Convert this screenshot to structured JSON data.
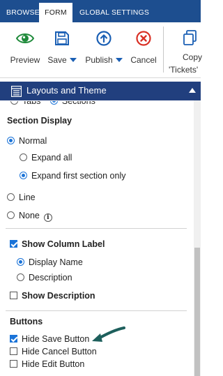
{
  "tabs": [
    {
      "label": "BROWSE",
      "active": false
    },
    {
      "label": "FORM",
      "active": true
    },
    {
      "label": "GLOBAL SETTINGS",
      "active": false
    }
  ],
  "ribbon": {
    "preview": {
      "label": "Preview",
      "icon": "eye-icon",
      "color": "#1e8a3a"
    },
    "save": {
      "label": "Save",
      "icon": "floppy-disk-icon",
      "color": "#1a5fb4"
    },
    "publish": {
      "label": "Publish",
      "icon": "arrow-up-circle-icon",
      "color": "#1a5fb4"
    },
    "cancel": {
      "label": "Cancel",
      "icon": "x-circle-icon",
      "color": "#d93025"
    },
    "copy": {
      "label_line1": "Copy",
      "label_line2": "'Tickets'",
      "icon": "copy-icon"
    }
  },
  "section": {
    "title": "Layouts and Theme",
    "icon": "layout-list-icon"
  },
  "form": {
    "partial_top": {
      "tabs_label": "Tabs",
      "sections_label": "Sections",
      "selected": "Sections"
    },
    "section_display": {
      "heading": "Section Display",
      "normal": "Normal",
      "expand_all": "Expand all",
      "expand_first": "Expand first section only",
      "line": "Line",
      "none": "None",
      "selected": "Normal",
      "sub_selected": "Expand first section only"
    },
    "column_label": {
      "show_column_label": "Show Column Label",
      "show_column_label_checked": true,
      "display_name": "Display Name",
      "description": "Description",
      "selected": "Display Name",
      "show_description": "Show Description",
      "show_description_checked": false
    },
    "buttons": {
      "heading": "Buttons",
      "hide_save": "Hide Save Button",
      "hide_save_checked": true,
      "hide_cancel": "Hide Cancel Button",
      "hide_cancel_checked": false,
      "hide_edit": "Hide Edit Button",
      "hide_edit_checked": false
    }
  },
  "colors": {
    "tab_bar": "#1d4e8f",
    "section_bar": "#213f7e",
    "accent": "#1a73d8",
    "annotation_arrow": "#1d5f5c"
  }
}
